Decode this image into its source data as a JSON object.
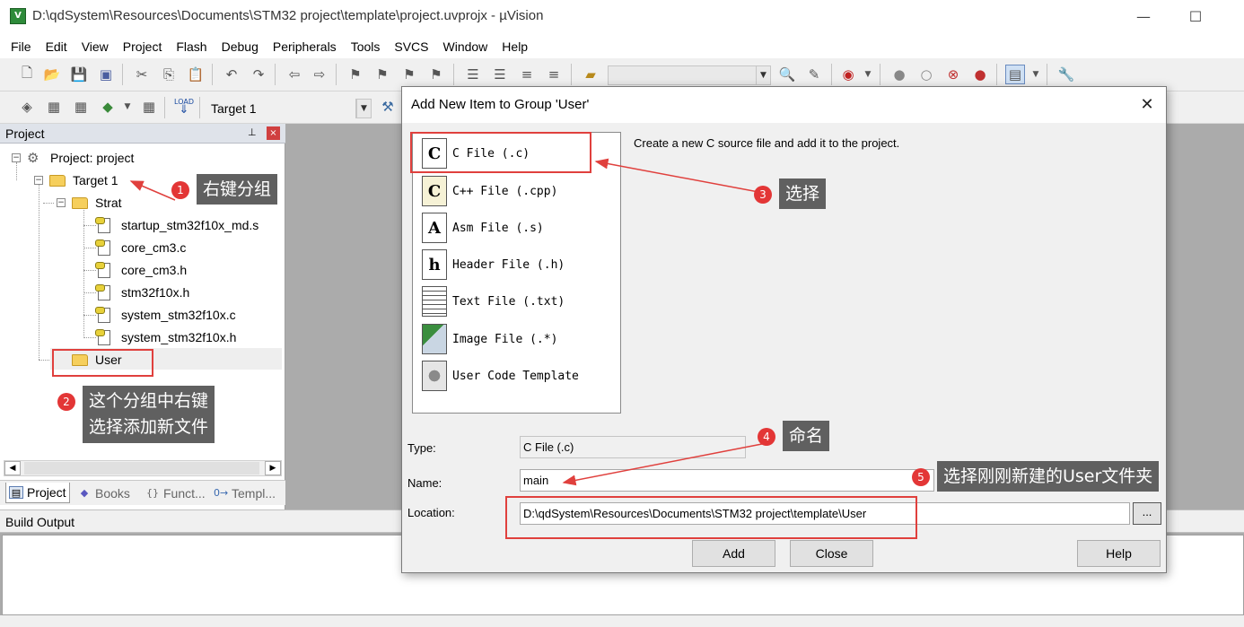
{
  "window": {
    "title": "D:\\qdSystem\\Resources\\Documents\\STM32 project\\template\\project.uvprojx - µVision",
    "minimize": "—",
    "maximize": "☐",
    "app_icon": "uv-app-icon"
  },
  "menu": [
    "File",
    "Edit",
    "View",
    "Project",
    "Flash",
    "Debug",
    "Peripherals",
    "Tools",
    "SVCS",
    "Window",
    "Help"
  ],
  "toolbar2": {
    "target_label": "Target 1",
    "load_label": "LOAD"
  },
  "project_panel": {
    "title": "Project",
    "pin": "⊥",
    "close": "×",
    "tree": {
      "root": "Project: project",
      "target": "Target 1",
      "group_strat": "Strat",
      "files": [
        "startup_stm32f10x_md.s",
        "core_cm3.c",
        "core_cm3.h",
        "stm32f10x.h",
        "system_stm32f10x.c",
        "system_stm32f10x.h"
      ],
      "group_user": "User"
    },
    "tabs": [
      {
        "label": "Project",
        "glyph": "▤"
      },
      {
        "label": "Books",
        "glyph": "◆"
      },
      {
        "label": "Funct...",
        "glyph": "{}"
      },
      {
        "label": "Templ...",
        "glyph": "0→"
      }
    ],
    "scroll_left": "◀",
    "scroll_right": "▶",
    "expander_minus": "−"
  },
  "build_output": {
    "title": "Build Output"
  },
  "dialog": {
    "title": "Add New Item to Group 'User'",
    "close": "✕",
    "types": [
      {
        "label": "C File (.c)",
        "glyph": "C"
      },
      {
        "label": "C++ File (.cpp)",
        "glyph": "C"
      },
      {
        "label": "Asm File (.s)",
        "glyph": "A"
      },
      {
        "label": "Header File (.h)",
        "glyph": "h"
      },
      {
        "label": "Text File (.txt)",
        "glyph": ""
      },
      {
        "label": "Image File (.*)",
        "glyph": ""
      },
      {
        "label": "User Code Template",
        "glyph": ""
      }
    ],
    "description": "Create a new C source file and add it to the project.",
    "type_label": "Type:",
    "type_value": "C File (.c)",
    "name_label": "Name:",
    "name_value": "main",
    "location_label": "Location:",
    "location_value": "D:\\qdSystem\\Resources\\Documents\\STM32 project\\template\\User",
    "browse": "...",
    "add": "Add",
    "close_btn": "Close",
    "help": "Help"
  },
  "annotations": [
    {
      "num": "1",
      "text": "右键分组"
    },
    {
      "num": "2",
      "text_line1": "这个分组中右键",
      "text_line2": "选择添加新文件"
    },
    {
      "num": "3",
      "text": "选择"
    },
    {
      "num": "4",
      "text": "命名"
    },
    {
      "num": "5",
      "text": "选择刚刚新建的User文件夹"
    }
  ],
  "colors": {
    "annotation_red": "#e0403d",
    "callout_bg": "#606060",
    "folder": "#f6cf5c"
  }
}
